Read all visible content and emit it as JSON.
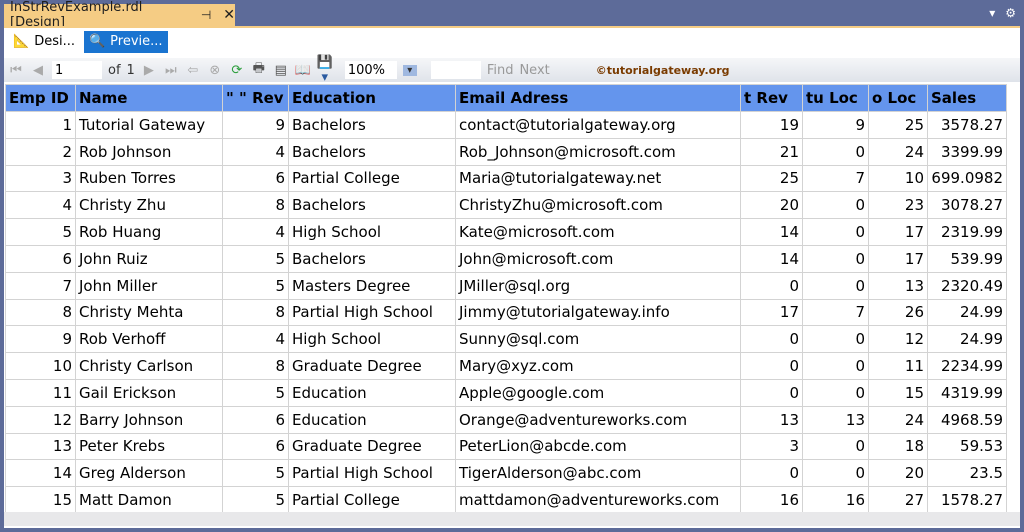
{
  "tab": {
    "title": "InStrRevExample.rdl [Design]",
    "pin": "⊣",
    "close": "✕"
  },
  "view_tabs": [
    {
      "label": "Desi..."
    },
    {
      "label": "Previe..."
    }
  ],
  "toolbar": {
    "page": "1",
    "of": "of",
    "total": "1",
    "zoom": "100%",
    "find": "Find",
    "next": "Next",
    "find_value": "",
    "watermark": "©tutorialgateway.org"
  },
  "columns": [
    "Emp ID",
    "Name",
    "\" \" Rev",
    "Education",
    "Email Adress",
    "t Rev",
    "tu  Loc",
    "o Loc",
    "Sales"
  ],
  "rows": [
    [
      "1",
      "Tutorial Gateway",
      "9",
      "Bachelors",
      "contact@tutorialgateway.org",
      "19",
      "9",
      "25",
      "3578.27"
    ],
    [
      "2",
      "Rob Johnson",
      "4",
      "Bachelors",
      "Rob_Johnson@microsoft.com",
      "21",
      "0",
      "24",
      "3399.99"
    ],
    [
      "3",
      "Ruben Torres",
      "6",
      "Partial College",
      "Maria@tutorialgateway.net",
      "25",
      "7",
      "10",
      "699.0982"
    ],
    [
      "4",
      "Christy Zhu",
      "8",
      "Bachelors",
      "ChristyZhu@microsoft.com",
      "20",
      "0",
      "23",
      "3078.27"
    ],
    [
      "5",
      "Rob Huang",
      "4",
      "High School",
      "Kate@microsoft.com",
      "14",
      "0",
      "17",
      "2319.99"
    ],
    [
      "6",
      "John Ruiz",
      "5",
      "Bachelors",
      "John@microsoft.com",
      "14",
      "0",
      "17",
      "539.99"
    ],
    [
      "7",
      "John Miller",
      "5",
      "Masters Degree",
      "JMiller@sql.org",
      "0",
      "0",
      "13",
      "2320.49"
    ],
    [
      "8",
      "Christy Mehta",
      "8",
      "Partial High School",
      "Jimmy@tutorialgateway.info",
      "17",
      "7",
      "26",
      "24.99"
    ],
    [
      "9",
      "Rob Verhoff",
      "4",
      "High School",
      "Sunny@sql.com",
      "0",
      "0",
      "12",
      "24.99"
    ],
    [
      "10",
      "Christy Carlson",
      "8",
      "Graduate Degree",
      "Mary@xyz.com",
      "0",
      "0",
      "11",
      "2234.99"
    ],
    [
      "11",
      "Gail Erickson",
      "5",
      "Education",
      "Apple@google.com",
      "0",
      "0",
      "15",
      "4319.99"
    ],
    [
      "12",
      "Barry Johnson",
      "6",
      "Education",
      "Orange@adventureworks.com",
      "13",
      "13",
      "24",
      "4968.59"
    ],
    [
      "13",
      "Peter Krebs",
      "6",
      "Graduate Degree",
      "PeterLion@abcde.com",
      "3",
      "0",
      "18",
      "59.53"
    ],
    [
      "14",
      "Greg Alderson",
      "5",
      "Partial High School",
      "TigerAlderson@abc.com",
      "0",
      "0",
      "20",
      "23.5"
    ],
    [
      "15",
      "Matt Damon",
      "5",
      "Partial College",
      "mattdamon@adventureworks.com",
      "16",
      "16",
      "27",
      "1578.27"
    ]
  ]
}
